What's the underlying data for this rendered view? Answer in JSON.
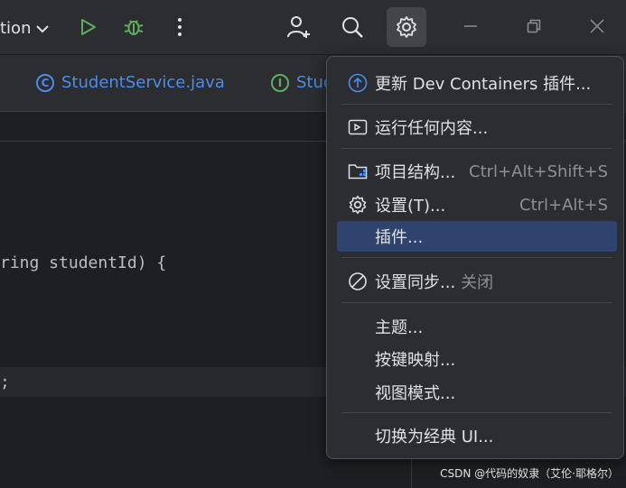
{
  "toolbar": {
    "run_config_label": "tion",
    "icons": [
      "chevron-down-icon",
      "run-icon",
      "debug-icon",
      "more-vert-icon",
      "add-user-icon",
      "search-icon",
      "gear-icon",
      "minimize-icon",
      "restore-icon",
      "close-icon"
    ]
  },
  "tabs": [
    {
      "label": "StudentService.java",
      "icon": "C",
      "kind": "class"
    },
    {
      "label": "Stud",
      "icon": "I",
      "kind": "interface"
    }
  ],
  "editor": {
    "lines": [
      "ring studentId) {",
      ";"
    ]
  },
  "menu": {
    "items": [
      {
        "label": "更新 Dev Containers 插件...",
        "icon": "update-arrow-icon"
      },
      {
        "label": "运行任何内容...",
        "icon": "run-anything-icon"
      },
      {
        "label": "项目结构...",
        "shortcut": "Ctrl+Alt+Shift+S",
        "icon": "project-structure-icon"
      },
      {
        "label": "设置(T)...",
        "shortcut": "Ctrl+Alt+S",
        "icon": "settings-gear-icon"
      },
      {
        "label": "插件...",
        "selected": true
      },
      {
        "label": "设置同步...",
        "trailing": "关闭",
        "icon": "sync-disabled-icon"
      },
      {
        "label": "主题..."
      },
      {
        "label": "按键映射..."
      },
      {
        "label": "视图模式..."
      },
      {
        "label": "切换为经典 UI..."
      }
    ]
  },
  "watermark": "CSDN @代码的奴隶（艾伦·耶格尔）",
  "colors": {
    "background": "#1e1f22",
    "panel": "#2b2d30",
    "accent_blue": "#4d8ce8",
    "run_green": "#5fae5f",
    "selection": "#2e436e"
  }
}
